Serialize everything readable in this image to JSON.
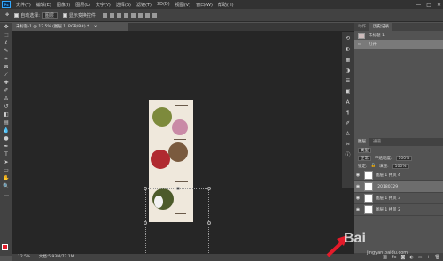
{
  "app": {
    "logo": "Ps"
  },
  "menu": [
    "文件(F)",
    "编辑(E)",
    "图像(I)",
    "图层(L)",
    "文字(Y)",
    "选择(S)",
    "滤镜(T)",
    "3D(D)",
    "视图(V)",
    "窗口(W)",
    "帮助(H)"
  ],
  "window_controls": [
    "—",
    "□",
    "✕"
  ],
  "options": {
    "auto_select_label": "自动选择:",
    "auto_select_value": "图层",
    "show_transform_label": "显示变换控件"
  },
  "document_tab": {
    "title": "未标题-1 @ 12.5% (图层 1, RGB/8#) *",
    "close": "×"
  },
  "status": {
    "zoom": "12.5%",
    "doc": "文档:5.93M/72.1M"
  },
  "history_panel": {
    "tabs": [
      "历史记录",
      "动作"
    ],
    "snapshot_label": "未标题-1",
    "items": [
      "打开"
    ]
  },
  "layers_panel": {
    "tabs": [
      "图层",
      "通道"
    ],
    "kind_label": "类型",
    "blend_mode": "正常",
    "opacity_label": "不透明度:",
    "opacity_value": "100%",
    "lock_label": "锁定:",
    "fill_label": "填充:",
    "fill_value": "100%",
    "layers": [
      {
        "name": "图层 1 拷贝 4",
        "visible": true,
        "selected": false
      },
      {
        "name": "_20180729",
        "visible": true,
        "selected": true
      },
      {
        "name": "图层 1 拷贝 3",
        "visible": true,
        "selected": false
      },
      {
        "name": "图层 1 拷贝 2",
        "visible": true,
        "selected": false
      }
    ]
  },
  "watermark": {
    "brand": "Bai",
    "site": "jingyan.baidu.com"
  },
  "colors": {
    "accent_red": "#e31b2a",
    "panel": "#535353",
    "canvas_bg": "#262626"
  }
}
